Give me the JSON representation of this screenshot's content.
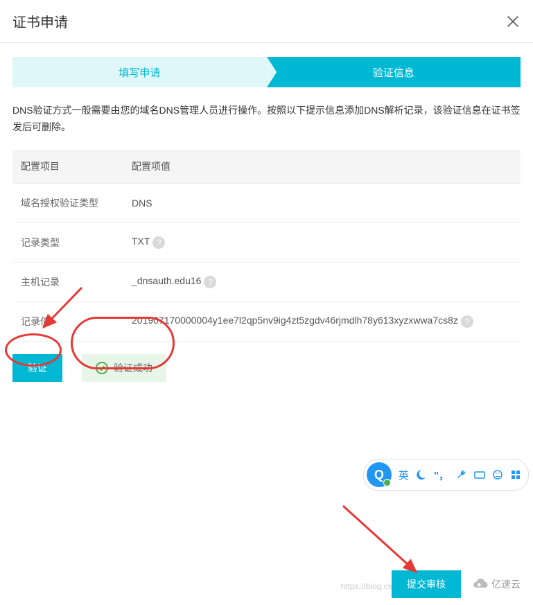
{
  "dialog": {
    "title": "证书申请"
  },
  "steps": {
    "step1": "填写申请",
    "step2": "验证信息"
  },
  "description": "DNS验证方式一般需要由您的域名DNS管理人员进行操作。按照以下提示信息添加DNS解析记录，该验证信息在证书签发后可删除。",
  "table": {
    "headers": {
      "col1": "配置项目",
      "col2": "配置项值"
    },
    "rows": [
      {
        "label": "域名授权验证类型",
        "value": "DNS"
      },
      {
        "label": "记录类型",
        "value": "TXT",
        "help": true
      },
      {
        "label": "主机记录",
        "value": "_dnsauth.edu16",
        "help": true
      },
      {
        "label": "记录值",
        "value": "201907170000004y1ee7l2qp5nv9ig4zt5zgdv46rjmdlh78y613xyzxwwa7cs8z",
        "help": true
      }
    ]
  },
  "actions": {
    "verify_label": "验证",
    "success_label": "验证成功",
    "submit_label": "提交审核"
  },
  "watermark": "https://blog.csdn.net",
  "brand": "亿速云",
  "toolbar": {
    "main": "Q",
    "lang": "英"
  },
  "colors": {
    "accent": "#00b8d4",
    "success": "#4caf50",
    "annotation": "#e53935"
  }
}
